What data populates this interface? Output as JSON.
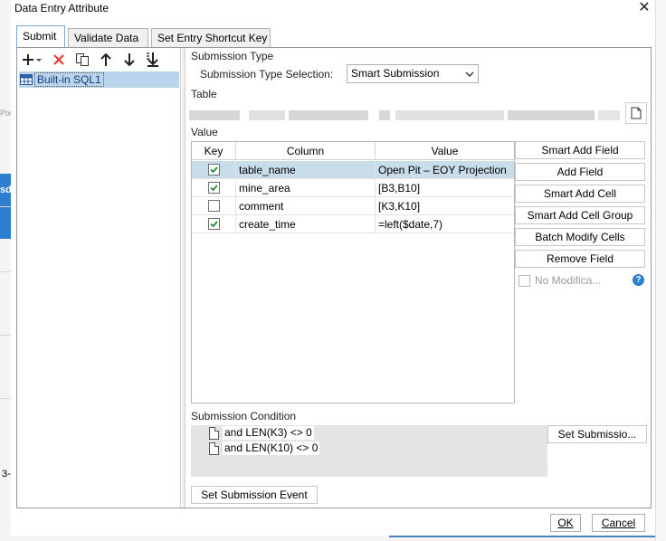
{
  "dialog": {
    "title": "Data Entry Attribute",
    "close_glyph": "✕",
    "tabs": [
      {
        "label": "Submit",
        "active": true
      },
      {
        "label": "Validate Data",
        "active": false
      },
      {
        "label": "Set Entry Shortcut Key",
        "active": false
      }
    ]
  },
  "background": {
    "left_fragment_1": "Pix",
    "left_fragment_2": "sd",
    "left_fragment_3": "3-"
  },
  "left_panel": {
    "toolbar_icons": [
      "add-icon",
      "delete-icon",
      "copy-icon",
      "move-up-icon",
      "move-down-icon",
      "move-bottom-icon"
    ],
    "tree": [
      {
        "label": "Built-in SQL1",
        "selected": true
      }
    ]
  },
  "submission_type": {
    "section_label": "Submission Type",
    "selection_label": "Submission Type Selection:",
    "selected_value": "Smart Submission"
  },
  "table_section": {
    "label": "Table"
  },
  "value_section": {
    "label": "Value",
    "columns": [
      "Key",
      "Column",
      "Value"
    ],
    "rows": [
      {
        "key": true,
        "column": "table_name",
        "value": "Open Pit – EOY Projection",
        "selected": true
      },
      {
        "key": true,
        "column": "mine_area",
        "value": "[B3,B10]",
        "selected": false
      },
      {
        "key": false,
        "column": "comment",
        "value": "[K3,K10]",
        "selected": false
      },
      {
        "key": true,
        "column": "create_time",
        "value": "=left($date,7)",
        "selected": false
      }
    ],
    "buttons": [
      "Smart Add Field",
      "Add Field",
      "Smart Add Cell",
      "Smart Add Cell Group",
      "Batch Modify Cells",
      "Remove Field"
    ],
    "no_modification_label": "No Modifica...",
    "help_glyph": "?"
  },
  "submission_condition": {
    "label": "Submission Condition",
    "lines": [
      "and LEN(K3) <> 0",
      "and LEN(K10) <> 0"
    ],
    "set_button": "Set Submissio..."
  },
  "event_button": "Set Submission Event",
  "footer": {
    "ok": "OK",
    "cancel": "Cancel"
  },
  "colors": {
    "selection": "#b9d5ee",
    "accent": "#2d7ed2",
    "delete": "#e53935"
  }
}
